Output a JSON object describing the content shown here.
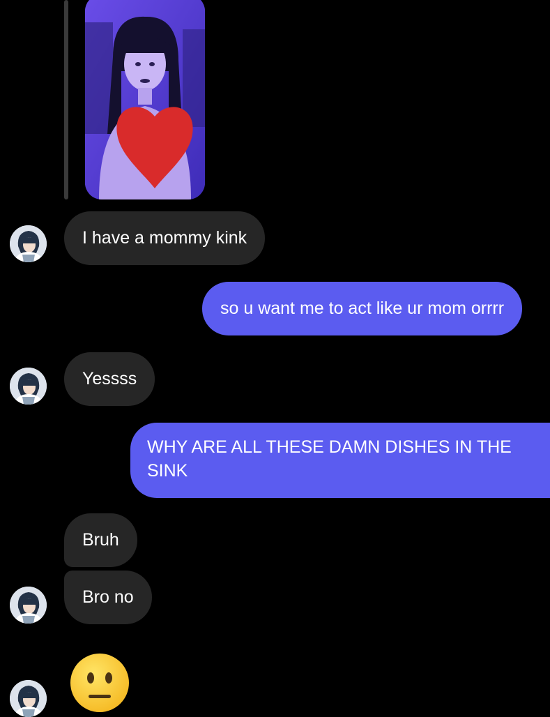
{
  "conversation": {
    "messages": [
      {
        "sender": "them",
        "text": "I have a mommy kink"
      },
      {
        "sender": "me",
        "text": "so u want me to act like ur mom orrrr"
      },
      {
        "sender": "them",
        "text": "Yessss"
      },
      {
        "sender": "me",
        "text": "WHY ARE ALL THESE DAMN DISHES IN THE SINK"
      },
      {
        "sender": "them",
        "text": "Bruh"
      },
      {
        "sender": "them",
        "text": "Bro no"
      }
    ],
    "last_reaction_emoji": "neutral-face-emoji"
  },
  "colors": {
    "background": "#000000",
    "incoming_bubble": "#262626",
    "outgoing_bubble": "#5b5cf0",
    "text": "#ffffff",
    "photo_tint": "#5b43d8",
    "heart": "#d92b2b"
  },
  "icons": {
    "avatar": "anime-character-avatar",
    "censor": "red-heart-censor"
  }
}
